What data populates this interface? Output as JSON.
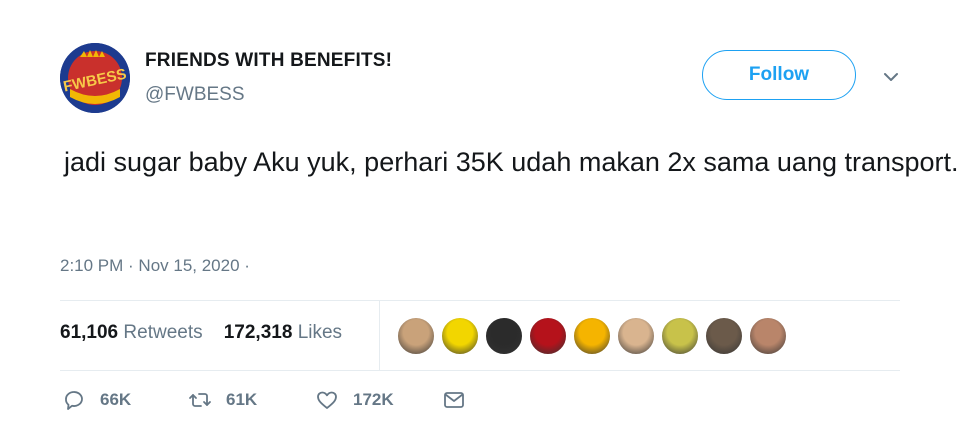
{
  "tweet": {
    "display_name": "FRIENDS WITH BENEFITS!",
    "handle": "@FWBESS",
    "avatar_text": "FWBESS",
    "follow_label": "Follow",
    "text": "jadi sugar baby Aku yuk, perhari 35K udah makan 2x sama uang transport.",
    "timestamp": "2:10 PM · Nov 15, 2020 ·",
    "retweets_count": "61,106",
    "retweets_label": "Retweets",
    "likes_count": "172,318",
    "likes_label": "Likes",
    "likers": [
      {
        "name": "liker-1",
        "color": "#c9a27a"
      },
      {
        "name": "liker-2",
        "color": "#f2d600"
      },
      {
        "name": "liker-3",
        "color": "#2b2b2b"
      },
      {
        "name": "liker-4",
        "color": "#b5121b"
      },
      {
        "name": "liker-5",
        "color": "#f5b400"
      },
      {
        "name": "liker-6",
        "color": "#d9b48f"
      },
      {
        "name": "liker-7",
        "color": "#c8c24a"
      },
      {
        "name": "liker-8",
        "color": "#6b5a4a"
      },
      {
        "name": "liker-9",
        "color": "#b9856a"
      }
    ],
    "actions": {
      "reply_count": "66K",
      "retweet_count": "61K",
      "like_count": "172K"
    },
    "colors": {
      "accent": "#1da1f2",
      "secondary_text": "#657786",
      "divider": "#e6ecf0"
    }
  }
}
